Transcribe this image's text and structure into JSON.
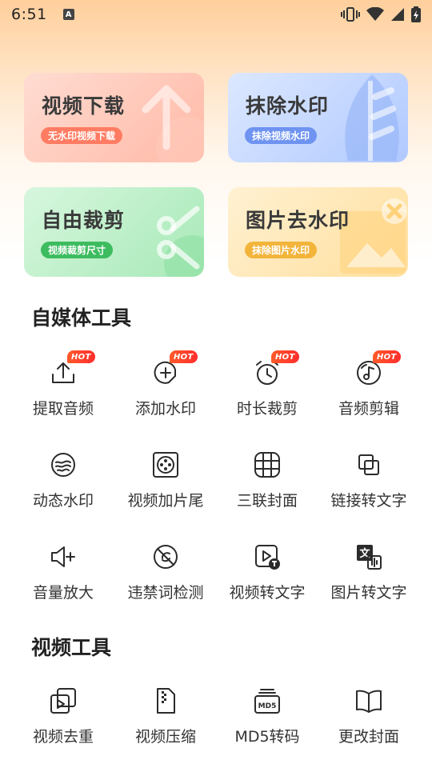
{
  "status_bar": {
    "time": "6:51",
    "notification_icon": "A"
  },
  "feature_cards": {
    "download": {
      "title": "视频下载",
      "tag": "无水印视频下载"
    },
    "remove_watermark": {
      "title": "抹除水印",
      "tag": "抹除视频水印"
    },
    "crop": {
      "title": "自由裁剪",
      "tag": "视频裁剪尺寸"
    },
    "image_watermark": {
      "title": "图片去水印",
      "tag": "抹除图片水印"
    }
  },
  "sections": {
    "media_tools": {
      "title": "自媒体工具",
      "items": [
        {
          "label": "提取音频",
          "icon": "upload-icon",
          "badge": "HOT"
        },
        {
          "label": "添加水印",
          "icon": "add-watermark-icon",
          "badge": "HOT"
        },
        {
          "label": "时长裁剪",
          "icon": "alarm-clock-icon",
          "badge": "HOT"
        },
        {
          "label": "音频剪辑",
          "icon": "music-note-icon",
          "badge": "HOT"
        },
        {
          "label": "动态水印",
          "icon": "waves-icon"
        },
        {
          "label": "视频加片尾",
          "icon": "film-reel-icon"
        },
        {
          "label": "三联封面",
          "icon": "grid-icon"
        },
        {
          "label": "链接转文字",
          "icon": "link-copy-icon"
        },
        {
          "label": "音量放大",
          "icon": "volume-up-icon"
        },
        {
          "label": "违禁词检测",
          "icon": "forbidden-icon"
        },
        {
          "label": "视频转文字",
          "icon": "video-text-icon"
        },
        {
          "label": "图片转文字",
          "icon": "image-text-icon"
        }
      ]
    },
    "video_tools": {
      "title": "视频工具",
      "items": [
        {
          "label": "视频去重",
          "icon": "video-dedupe-icon"
        },
        {
          "label": "视频压缩",
          "icon": "zip-file-icon"
        },
        {
          "label": "MD5转码",
          "icon": "md5-icon",
          "icon_text": "MD5"
        },
        {
          "label": "更改封面",
          "icon": "open-book-icon"
        }
      ]
    }
  },
  "colors": {
    "download_tag": "#ff7c62",
    "watermark_tag": "#6e93f0",
    "crop_tag": "#3dbc5f",
    "image_tag": "#f2b43a",
    "hot_badge": "#ff3d2a"
  }
}
